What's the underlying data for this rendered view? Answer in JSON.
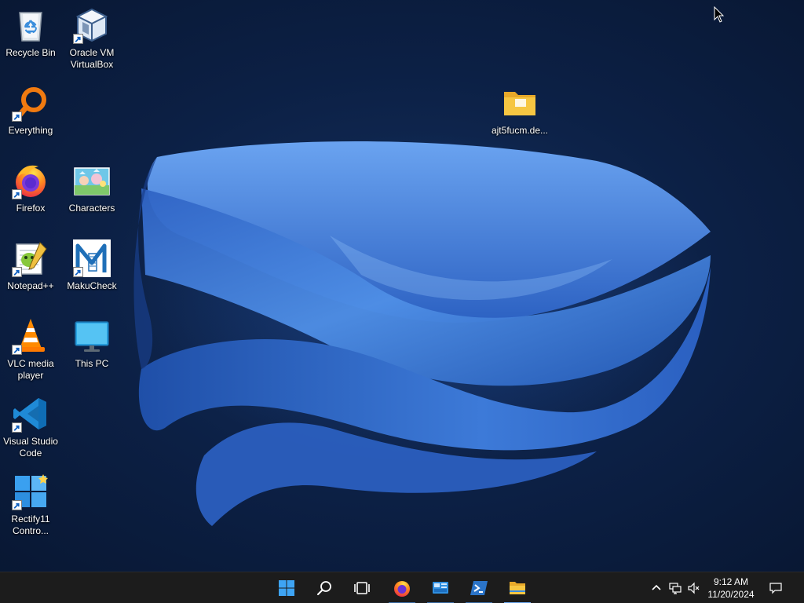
{
  "desktop": {
    "icons": [
      {
        "label": "Recycle Bin",
        "icon": "recycle-bin-icon",
        "shortcut": false
      },
      {
        "label": "Oracle VM VirtualBox",
        "icon": "virtualbox-icon",
        "shortcut": true
      },
      {
        "label": "Everything",
        "icon": "everything-search-icon",
        "shortcut": true
      },
      {
        "label": "Firefox",
        "icon": "firefox-icon",
        "shortcut": true
      },
      {
        "label": "Characters",
        "icon": "characters-image-icon",
        "shortcut": false
      },
      {
        "label": "Notepad++",
        "icon": "notepad-plus-plus-icon",
        "shortcut": true
      },
      {
        "label": "MakuCheck",
        "icon": "makucheck-icon",
        "shortcut": true
      },
      {
        "label": "VLC media player",
        "icon": "vlc-cone-icon",
        "shortcut": true
      },
      {
        "label": "This PC",
        "icon": "monitor-icon",
        "shortcut": false
      },
      {
        "label": "Visual Studio Code",
        "icon": "vscode-icon",
        "shortcut": true
      },
      {
        "label": "Rectify11 Contro...",
        "icon": "rectify11-icon",
        "shortcut": true
      },
      {
        "label": "ajt5fucm.de...",
        "icon": "folder-icon",
        "shortcut": false
      }
    ]
  },
  "taskbar": {
    "buttons": [
      {
        "name": "start",
        "icon": "windows-logo-icon",
        "running": false
      },
      {
        "name": "search",
        "icon": "search-icon",
        "running": false
      },
      {
        "name": "task-view",
        "icon": "task-view-icon",
        "running": false
      },
      {
        "name": "firefox",
        "icon": "firefox-icon",
        "running": true
      },
      {
        "name": "control-panel",
        "icon": "control-panel-icon",
        "running": true
      },
      {
        "name": "powershell",
        "icon": "powershell-icon",
        "running": true
      },
      {
        "name": "file-explorer",
        "icon": "folder-icon",
        "running": true
      }
    ],
    "tray": {
      "icons": [
        "chevron-up-icon",
        "network-icon",
        "volume-muted-icon",
        "notification-icon"
      ]
    },
    "clock": {
      "time": "9:12 AM",
      "date": "11/20/2024"
    }
  },
  "colors": {
    "taskbar_bg": "#1c1c1c",
    "desktop_bg": "#0c2045",
    "wallpaper_blue": "#3a78d6",
    "folder_yellow": "#f6c642"
  }
}
